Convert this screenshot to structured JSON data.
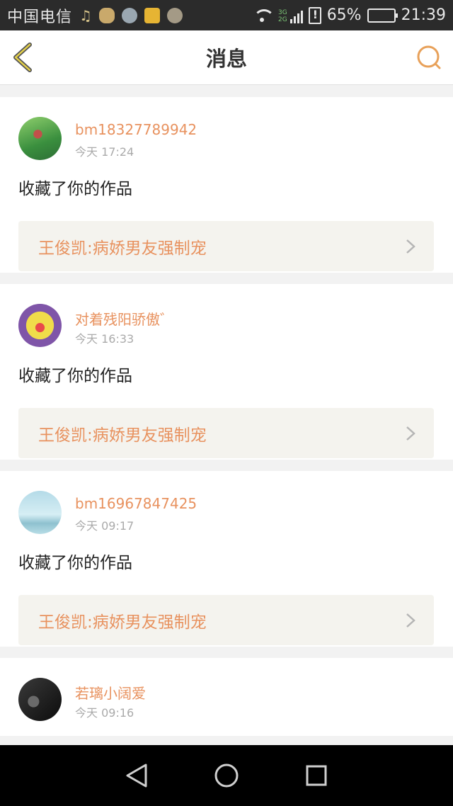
{
  "status_bar": {
    "carrier": "中国电信",
    "battery_percent": "65%",
    "time": "21:39",
    "net_labels": [
      "3G",
      "2G"
    ],
    "icons": [
      "music-icon",
      "chat-icon",
      "bird-icon",
      "star-icon",
      "coin-icon",
      "wifi-icon",
      "signal-icon",
      "sim-alert-icon",
      "battery-icon"
    ]
  },
  "header": {
    "title": "消息",
    "back_icon": "chevron-left-icon",
    "search_icon": "search-icon",
    "accent_color": "#e8a15a"
  },
  "messages": [
    {
      "username": "bm18327789942",
      "time": "今天 17:24",
      "action": "收藏了你的作品",
      "work_title": "王俊凯:病娇男友强制宠"
    },
    {
      "username": "对着残阳骄傲゛",
      "time": "今天 16:33",
      "action": "收藏了你的作品",
      "work_title": "王俊凯:病娇男友强制宠"
    },
    {
      "username": "bm16967847425",
      "time": "今天 09:17",
      "action": "收藏了你的作品",
      "work_title": "王俊凯:病娇男友强制宠"
    },
    {
      "username": "若璃小阔爱",
      "time": "今天 09:16"
    }
  ],
  "colors": {
    "username": "#e8925f",
    "card_link_bg": "#f4f3ee",
    "page_bg": "#f2f2f2"
  }
}
